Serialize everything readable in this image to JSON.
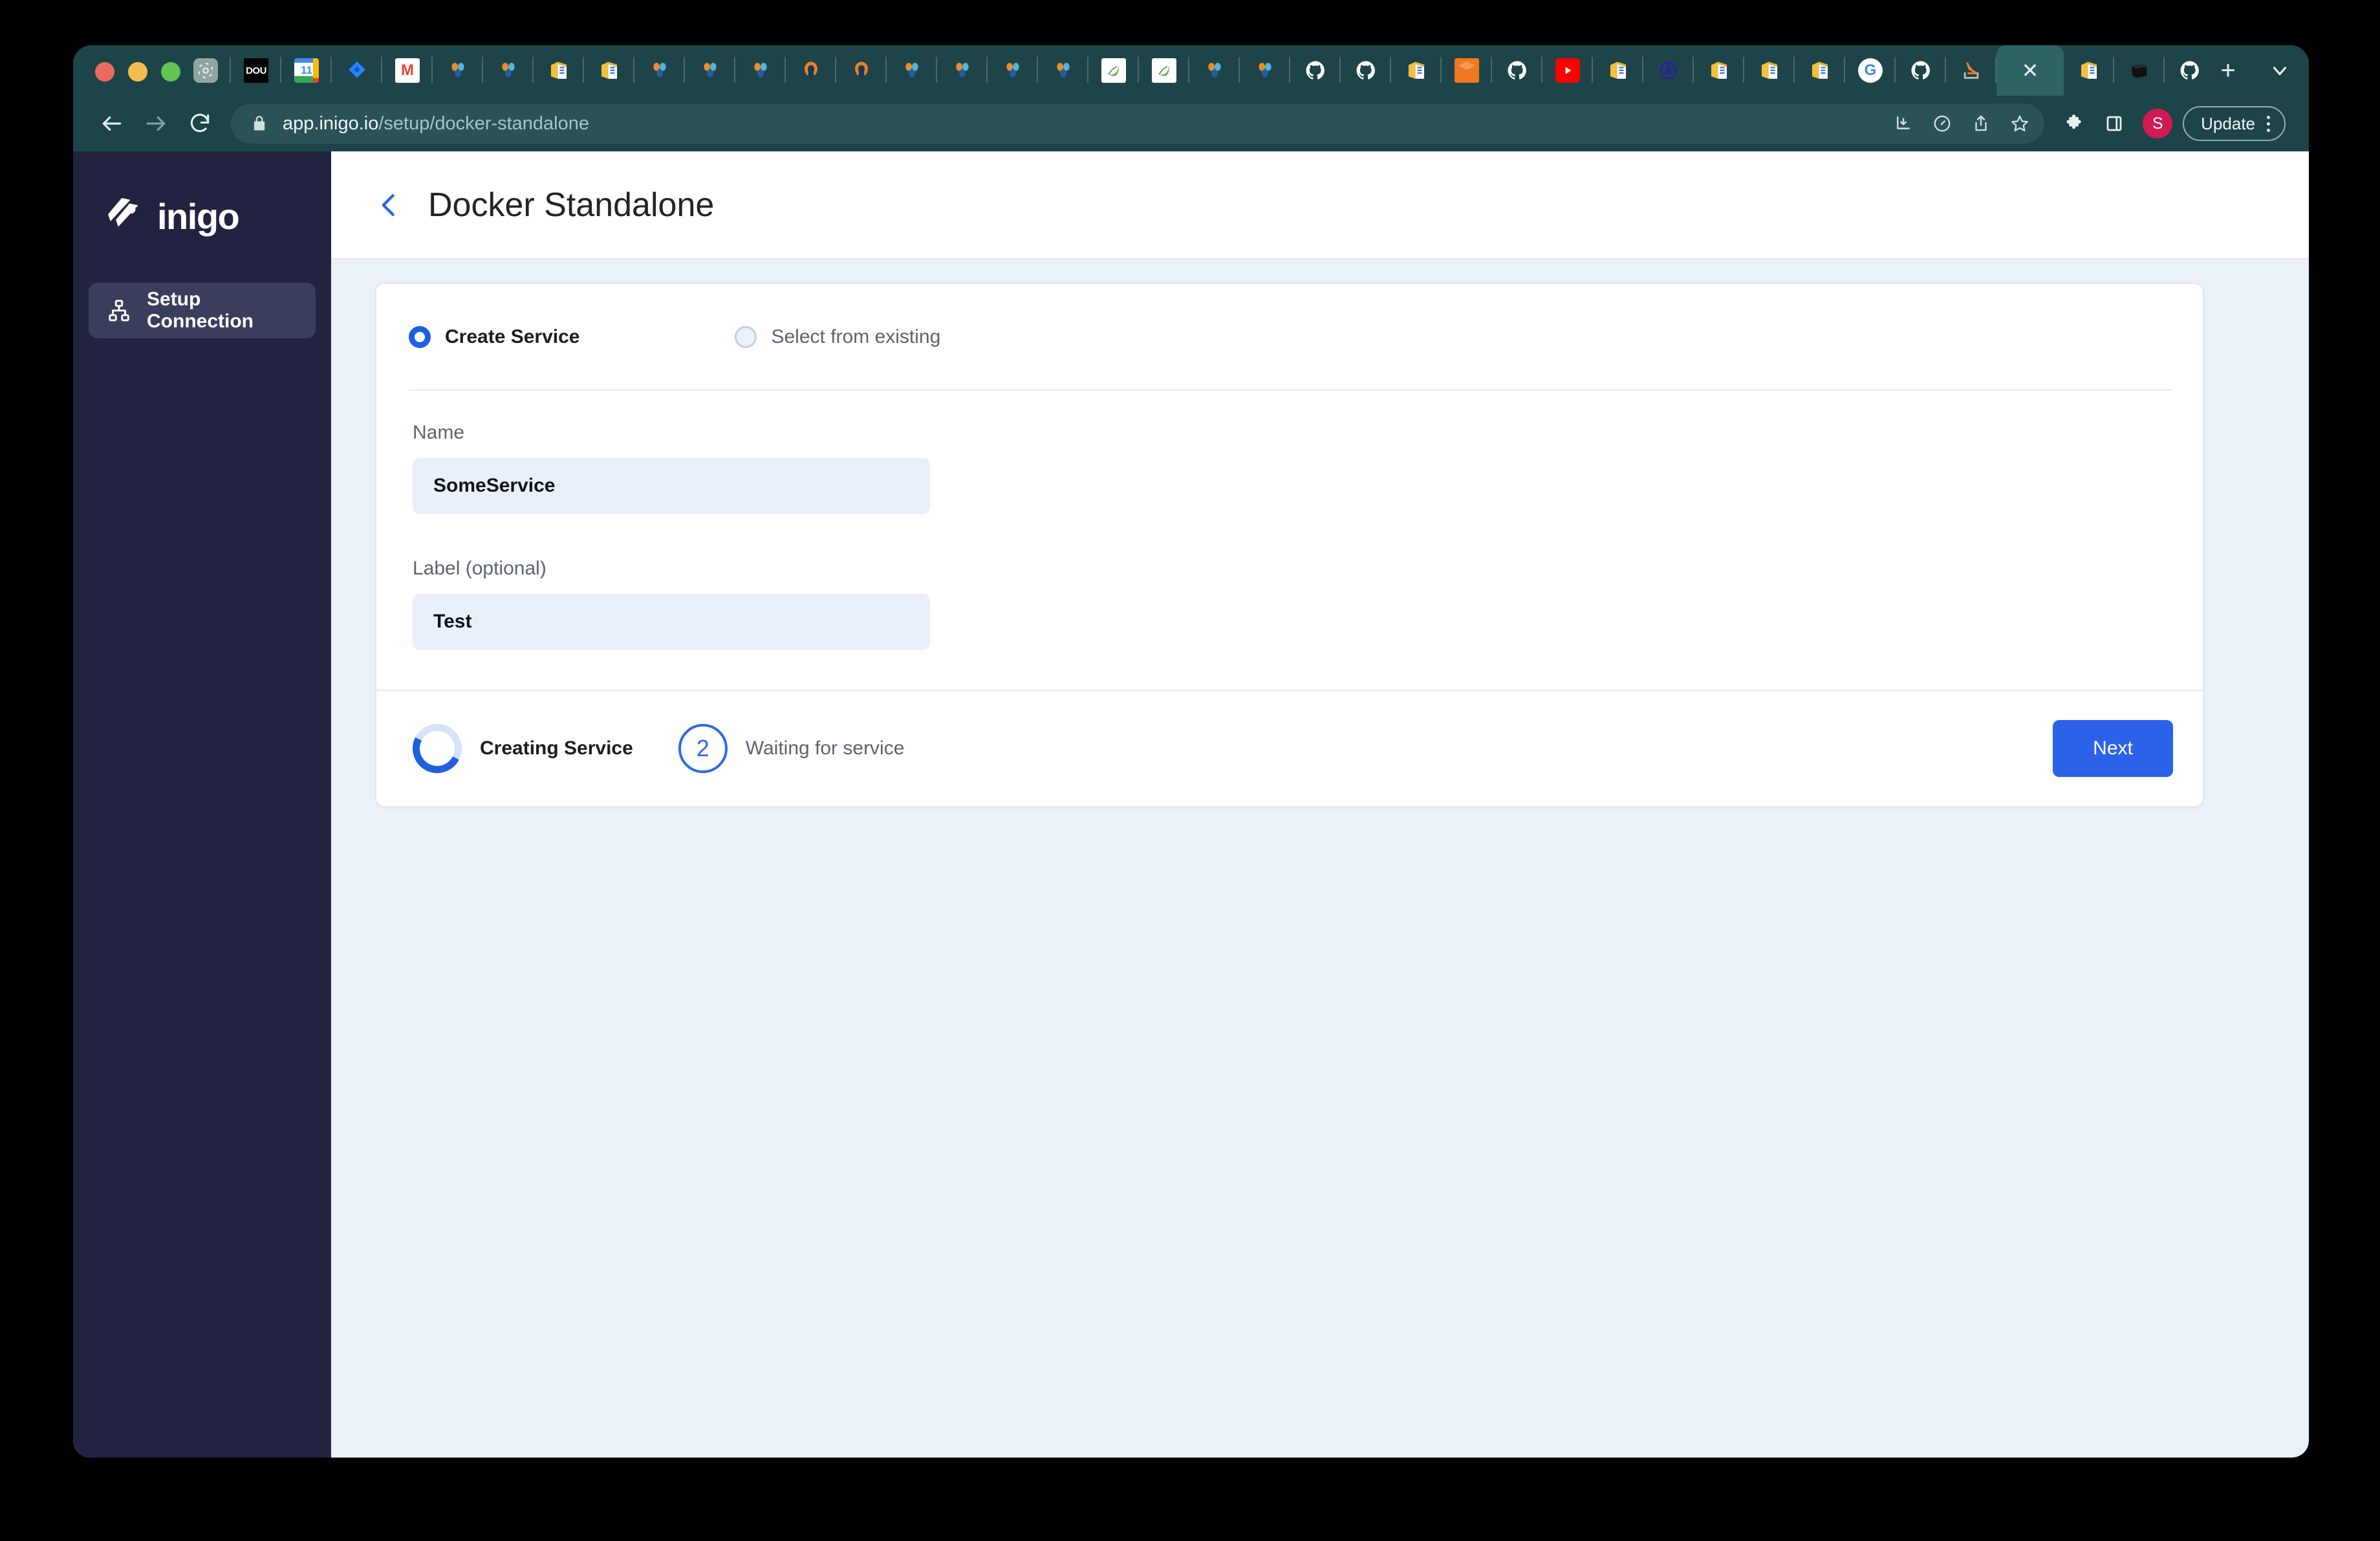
{
  "browser": {
    "traffic_lights": [
      "close",
      "minimize",
      "maximize"
    ],
    "tabs": [
      {
        "icon": "openai-icon",
        "kind": "openai",
        "active": false
      },
      {
        "icon": "dou-icon",
        "kind": "dou",
        "label": "DOU",
        "active": false
      },
      {
        "icon": "google-calendar-icon",
        "kind": "gcal",
        "label": "11",
        "active": false
      },
      {
        "icon": "jira-icon",
        "kind": "jira",
        "active": false
      },
      {
        "icon": "gmail-icon",
        "kind": "gmail",
        "label": "M",
        "active": false
      },
      {
        "icon": "grafana-icon",
        "kind": "grafana",
        "active": false
      },
      {
        "icon": "grafana-icon",
        "kind": "grafana",
        "active": false
      },
      {
        "icon": "box-icon",
        "kind": "box",
        "active": false
      },
      {
        "icon": "box-icon",
        "kind": "box",
        "active": false
      },
      {
        "icon": "grafana-icon",
        "kind": "grafana",
        "active": false
      },
      {
        "icon": "grafana-icon",
        "kind": "grafana",
        "active": false
      },
      {
        "icon": "grafana-icon",
        "kind": "grafana",
        "active": false
      },
      {
        "icon": "arch-icon",
        "kind": "arch",
        "active": false
      },
      {
        "icon": "arch-icon",
        "kind": "arch",
        "active": false
      },
      {
        "icon": "grafana-icon",
        "kind": "grafana",
        "active": false
      },
      {
        "icon": "grafana-icon",
        "kind": "grafana",
        "active": false
      },
      {
        "icon": "grafana-icon",
        "kind": "grafana",
        "active": false
      },
      {
        "icon": "grafana-icon",
        "kind": "grafana",
        "active": false
      },
      {
        "icon": "leaf-icon",
        "kind": "leaf",
        "active": false
      },
      {
        "icon": "leaf-icon",
        "kind": "leaf",
        "active": false
      },
      {
        "icon": "grafana-icon",
        "kind": "grafana",
        "active": false
      },
      {
        "icon": "grafana-icon",
        "kind": "grafana",
        "active": false
      },
      {
        "icon": "github-icon",
        "kind": "github",
        "active": false
      },
      {
        "icon": "github-icon",
        "kind": "github",
        "active": false
      },
      {
        "icon": "box-icon",
        "kind": "box",
        "active": false
      },
      {
        "icon": "inigo-icon",
        "kind": "inigoF",
        "active": false
      },
      {
        "icon": "github-icon",
        "kind": "github",
        "active": false
      },
      {
        "icon": "youtube-icon",
        "kind": "yt",
        "active": false
      },
      {
        "icon": "box-icon",
        "kind": "box",
        "active": false
      },
      {
        "icon": "atlas-icon",
        "kind": "atlas",
        "label": "A",
        "active": false
      },
      {
        "icon": "box-icon",
        "kind": "box",
        "active": false
      },
      {
        "icon": "box-icon",
        "kind": "box",
        "active": false
      },
      {
        "icon": "box-icon",
        "kind": "box",
        "active": false
      },
      {
        "icon": "google-icon",
        "kind": "google",
        "label": "G",
        "active": false
      },
      {
        "icon": "github-icon",
        "kind": "github",
        "active": false
      },
      {
        "icon": "stackoverflow-icon",
        "kind": "so",
        "active": false
      },
      {
        "icon": "close-icon",
        "kind": "active",
        "active": true
      },
      {
        "icon": "box-icon",
        "kind": "box",
        "active": false
      },
      {
        "icon": "dark-icon",
        "kind": "dark",
        "active": false
      },
      {
        "icon": "github-icon",
        "kind": "github",
        "active": false
      },
      {
        "icon": "inigo-icon",
        "kind": "inigoF",
        "active": false
      },
      {
        "icon": "inigo-outline-icon",
        "kind": "inigoOutline",
        "active": false
      },
      {
        "icon": "inigo-icon",
        "kind": "inigoF",
        "active": false
      },
      {
        "icon": "inigo-icon",
        "kind": "inigoF",
        "active": false
      },
      {
        "icon": "notion-icon",
        "kind": "notion",
        "active": false
      },
      {
        "icon": "box-icon",
        "kind": "box",
        "active": false
      }
    ],
    "new_tab_label": "+",
    "toolbar": {
      "back": "back-arrow",
      "forward": "forward-arrow",
      "reload": "reload",
      "url_host": "app.inigo.io",
      "url_path": "/setup/docker-standalone",
      "update_label": "Update",
      "avatar_initial": "S"
    }
  },
  "sidebar": {
    "brand": "inigo",
    "items": [
      {
        "label": "Setup Connection",
        "icon": "sitemap-icon",
        "active": true
      }
    ]
  },
  "header": {
    "back_icon": "chevron-left-icon",
    "title": "Docker Standalone"
  },
  "form": {
    "options": [
      {
        "label": "Create Service",
        "selected": true
      },
      {
        "label": "Select from existing",
        "selected": false
      }
    ],
    "fields": [
      {
        "label": "Name",
        "value": "SomeService",
        "placeholder": "Name"
      },
      {
        "label": "Label (optional)",
        "value": "Test",
        "placeholder": "Label"
      }
    ]
  },
  "footer": {
    "steps": [
      {
        "indicator": "spinner",
        "label": "Creating Service",
        "state": "active"
      },
      {
        "indicator": "2",
        "label": "Waiting for service",
        "state": "pending"
      }
    ],
    "next_label": "Next"
  },
  "colors": {
    "accent_blue": "#2b62e8",
    "browser_chrome": "#1d4448",
    "sidebar_bg": "#222340",
    "page_bg": "#eaf1f9",
    "input_bg": "#e9f0fa"
  }
}
